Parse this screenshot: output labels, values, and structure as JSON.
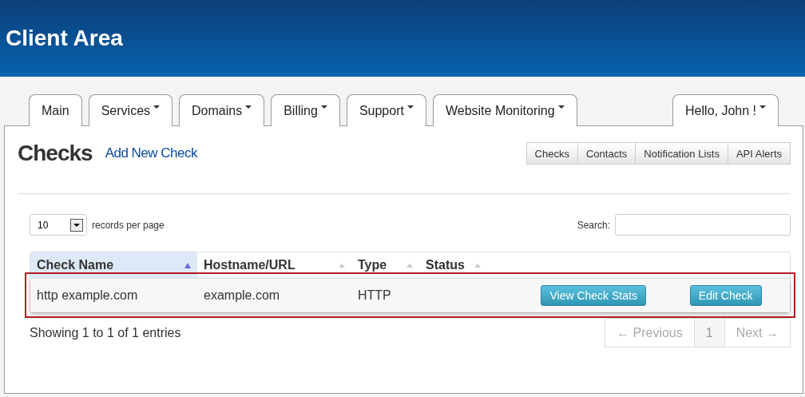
{
  "header": {
    "title": "Client Area"
  },
  "nav": [
    {
      "label": "Main",
      "dropdown": false
    },
    {
      "label": "Services",
      "dropdown": true
    },
    {
      "label": "Domains",
      "dropdown": true
    },
    {
      "label": "Billing",
      "dropdown": true
    },
    {
      "label": "Support",
      "dropdown": true
    },
    {
      "label": "Website Monitoring",
      "dropdown": true
    }
  ],
  "user_menu": {
    "label": "Hello, John !",
    "dropdown": true
  },
  "page": {
    "title": "Checks",
    "link": "Add New Check"
  },
  "subnav": [
    "Checks",
    "Contacts",
    "Notification Lists",
    "API Alerts"
  ],
  "length": {
    "value": "10",
    "label": "records per page"
  },
  "search": {
    "label": "Search:"
  },
  "table": {
    "columns": [
      {
        "label": "Check Name",
        "sorted": true
      },
      {
        "label": "Hostname/URL",
        "sorted": false
      },
      {
        "label": "Type",
        "sorted": false
      },
      {
        "label": "Status",
        "sorted": false
      }
    ],
    "rows": [
      {
        "highlighted": true,
        "cells": [
          "http example.com",
          "example.com",
          "HTTP"
        ],
        "actions": [
          "View Check Stats",
          "Edit Check"
        ]
      }
    ]
  },
  "info": "Showing 1 to 1 of 1 entries",
  "pagination": [
    {
      "label": "← Previous",
      "disabled": true,
      "selected": false
    },
    {
      "label": "1",
      "disabled": false,
      "selected": true
    },
    {
      "label": "Next →",
      "disabled": true,
      "selected": false
    }
  ]
}
